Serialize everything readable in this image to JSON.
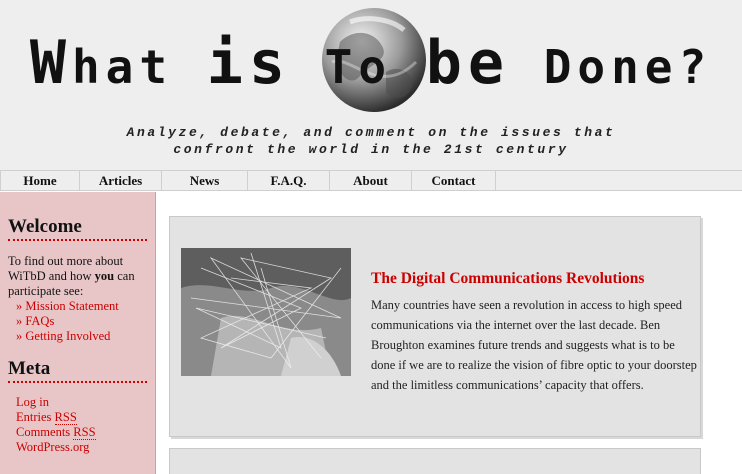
{
  "site": {
    "title_w": "W",
    "title_rest": "hat ",
    "title_is": "is",
    "title_to": " To ",
    "title_be": "be",
    "title_done": " Done?",
    "tagline_line1": "Analyze, debate, and comment on the issues that",
    "tagline_line2": "confront the world in the 21st century"
  },
  "nav": {
    "items": [
      {
        "label": "Home"
      },
      {
        "label": "Articles"
      },
      {
        "label": "News"
      },
      {
        "label": "F.A.Q."
      },
      {
        "label": "About"
      },
      {
        "label": "Contact"
      }
    ]
  },
  "sidebar": {
    "welcome_heading": "Welcome",
    "welcome_text_1": "To find out more about WiTbD and how ",
    "welcome_text_you": "you",
    "welcome_text_2": " can participate see:",
    "links": [
      {
        "label": "» Mission Statement"
      },
      {
        "label": "» FAQs"
      },
      {
        "label": "» Getting Involved"
      }
    ],
    "meta_heading": "Meta",
    "meta_login": "Log in",
    "meta_entries": "Entries ",
    "meta_comments": "Comments ",
    "meta_rss": "RSS",
    "meta_wordpress": "WordPress.org"
  },
  "post": {
    "title": "The Digital Communications Revolutions",
    "excerpt": "Many countries have seen a revolution in access to high speed communications via the internet over the last decade. Ben Broughton examines future trends and suggests what is to be done if we are to realize the vision of fibre optic to your doorstep and the limitless communications’ capacity that offers."
  },
  "colors": {
    "accent": "#cc0000",
    "sidebar_bg": "#e8c6c8",
    "header_bg": "#eeeeee",
    "post_bg": "#e3e3e3"
  }
}
